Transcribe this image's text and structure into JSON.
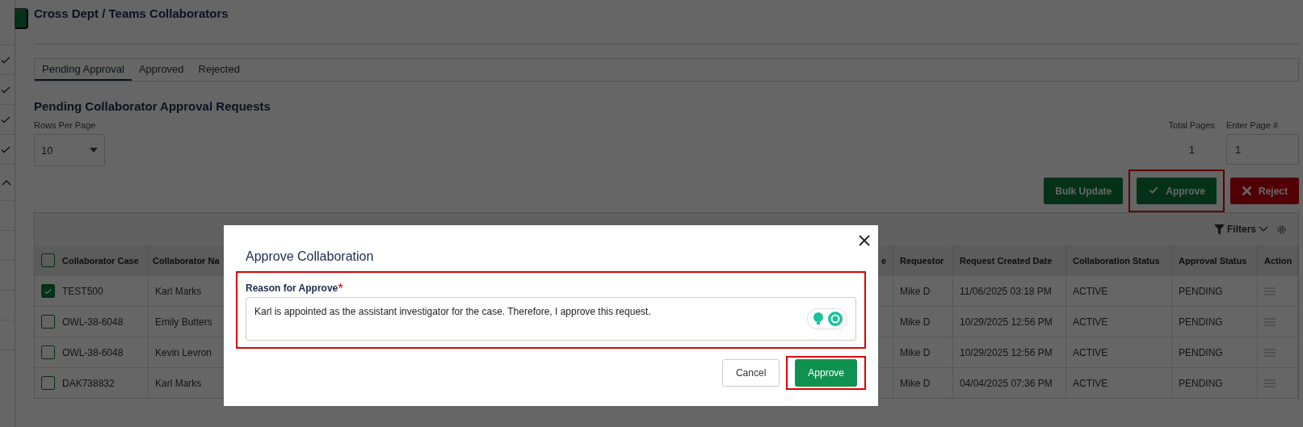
{
  "page": {
    "title": "Cross Dept / Teams Collaborators"
  },
  "sidebar": {
    "items": [
      {
        "kind": "check"
      },
      {
        "kind": "check"
      },
      {
        "kind": "check"
      },
      {
        "kind": "check"
      },
      {
        "kind": "caret"
      }
    ]
  },
  "tabs": [
    {
      "label": "Pending Approval",
      "selected": true
    },
    {
      "label": "Approved",
      "selected": false
    },
    {
      "label": "Rejected",
      "selected": false
    }
  ],
  "section_title": "Pending Collaborator Approval Requests",
  "rows_per_page": {
    "label": "Rows Per Page",
    "value": "10"
  },
  "total_pages": {
    "label": "Total Pages",
    "value": "1"
  },
  "page_input": {
    "label": "Enter Page #",
    "value": "1"
  },
  "actions": [
    {
      "kind": "plain",
      "label": "Bulk Update",
      "highlighted": false
    },
    {
      "kind": "approve",
      "label": "Approve",
      "highlighted": true
    },
    {
      "kind": "reject",
      "label": "Reject",
      "highlighted": false
    }
  ],
  "filters": {
    "label": "Filters"
  },
  "table": {
    "select_all": {
      "checked": false
    },
    "columns": [
      "Collaborator Case",
      "Collaborator Na",
      "e",
      "Requestor",
      "Request Created Date",
      "Collaboration Status",
      "Approval Status",
      "Action"
    ],
    "rows": [
      {
        "checked": true,
        "cells": [
          "TEST500",
          "Karl Marks",
          "",
          "Mike D",
          "11/06/2025 03:18 PM",
          "ACTIVE",
          "PENDING"
        ]
      },
      {
        "checked": false,
        "cells": [
          "OWL-38-6048",
          "Emily Butters",
          "",
          "Mike D",
          "10/29/2025 12:56 PM",
          "ACTIVE",
          "PENDING"
        ]
      },
      {
        "checked": false,
        "cells": [
          "OWL-38-6048",
          "Kevin Levron",
          "",
          "Mike D",
          "10/29/2025 12:56 PM",
          "ACTIVE",
          "PENDING"
        ]
      },
      {
        "checked": false,
        "cells": [
          "DAK738832",
          "Karl Marks",
          "",
          "Mike D",
          "04/04/2025 07:36 PM",
          "ACTIVE",
          "PENDING"
        ]
      }
    ]
  },
  "dialog": {
    "title": "Approve Collaboration",
    "field_label": "Reason for Approve",
    "required_mark": "*",
    "value": "Karl is appointed as the assistant investigator for the case. Therefore, I approve this request.",
    "buttons": [
      {
        "kind": "cancel",
        "label": "Cancel",
        "highlighted": false
      },
      {
        "kind": "approve",
        "label": "Approve",
        "highlighted": true
      }
    ]
  }
}
